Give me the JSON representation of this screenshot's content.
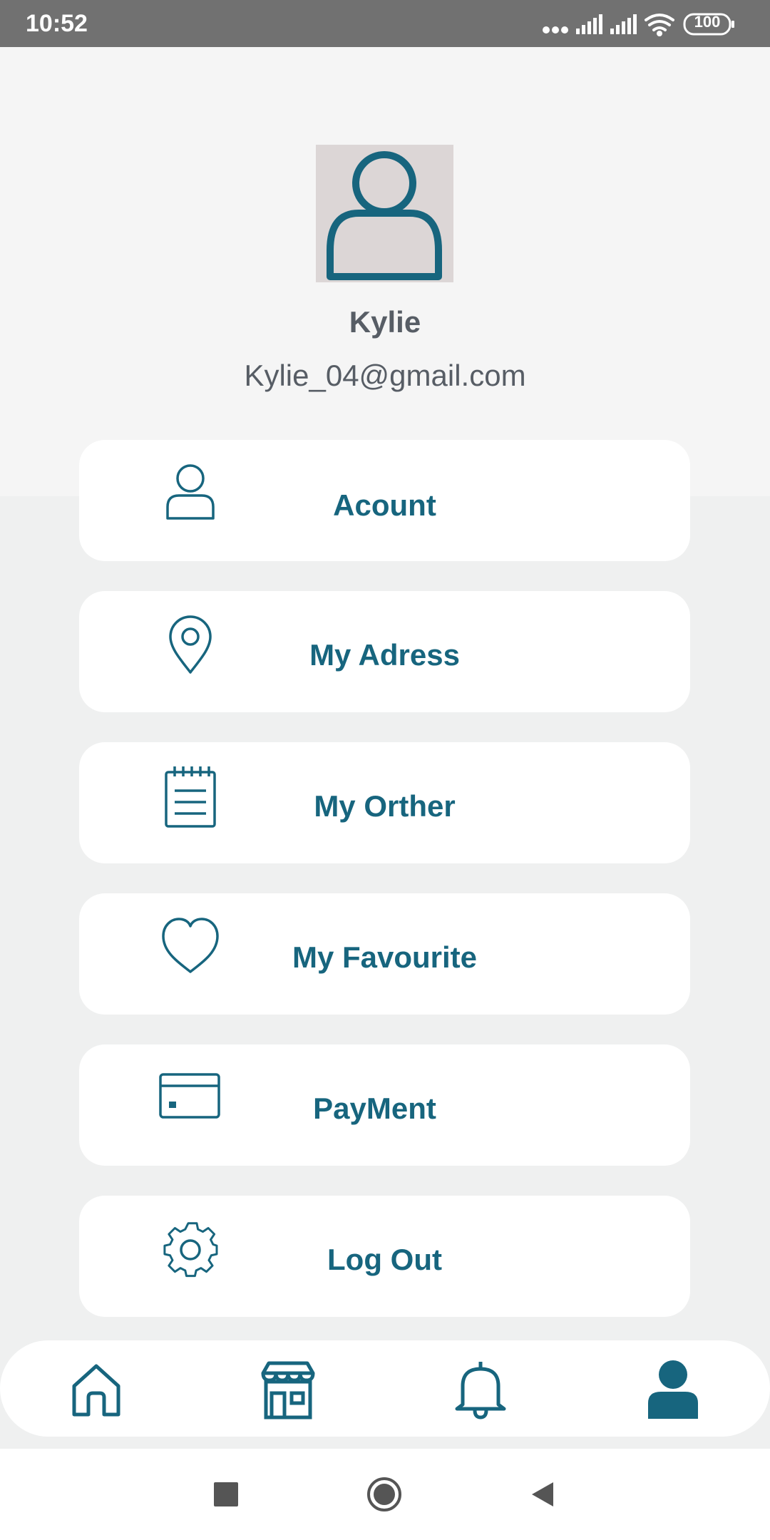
{
  "status_bar": {
    "time": "10:52",
    "battery": "100",
    "icons": [
      "more-dots-icon",
      "signal-icon",
      "signal-icon",
      "wifi-icon",
      "battery-icon"
    ]
  },
  "profile": {
    "name": "Kylie",
    "email": "Kylie_04@gmail.com",
    "avatar_icon": "user-avatar-icon"
  },
  "menu": {
    "items": [
      {
        "label": "Acount",
        "icon": "user-icon"
      },
      {
        "label": "My Adress",
        "icon": "location-pin-icon"
      },
      {
        "label": "My Orther",
        "icon": "notepad-icon"
      },
      {
        "label": "My Favourite",
        "icon": "heart-icon"
      },
      {
        "label": "PayMent",
        "icon": "credit-card-icon"
      },
      {
        "label": "Log Out",
        "icon": "gear-icon"
      }
    ]
  },
  "bottom_nav": {
    "items": [
      {
        "icon": "home-icon",
        "active": false
      },
      {
        "icon": "store-icon",
        "active": false
      },
      {
        "icon": "bell-icon",
        "active": false
      },
      {
        "icon": "profile-icon",
        "active": true
      }
    ]
  },
  "colors": {
    "accent": "#17657e",
    "text_gray": "#575d65",
    "card_bg": "#ffffff",
    "page_bg": "#eff0f0",
    "header_bg": "#f5f5f5",
    "status_bar_bg": "#717171"
  }
}
